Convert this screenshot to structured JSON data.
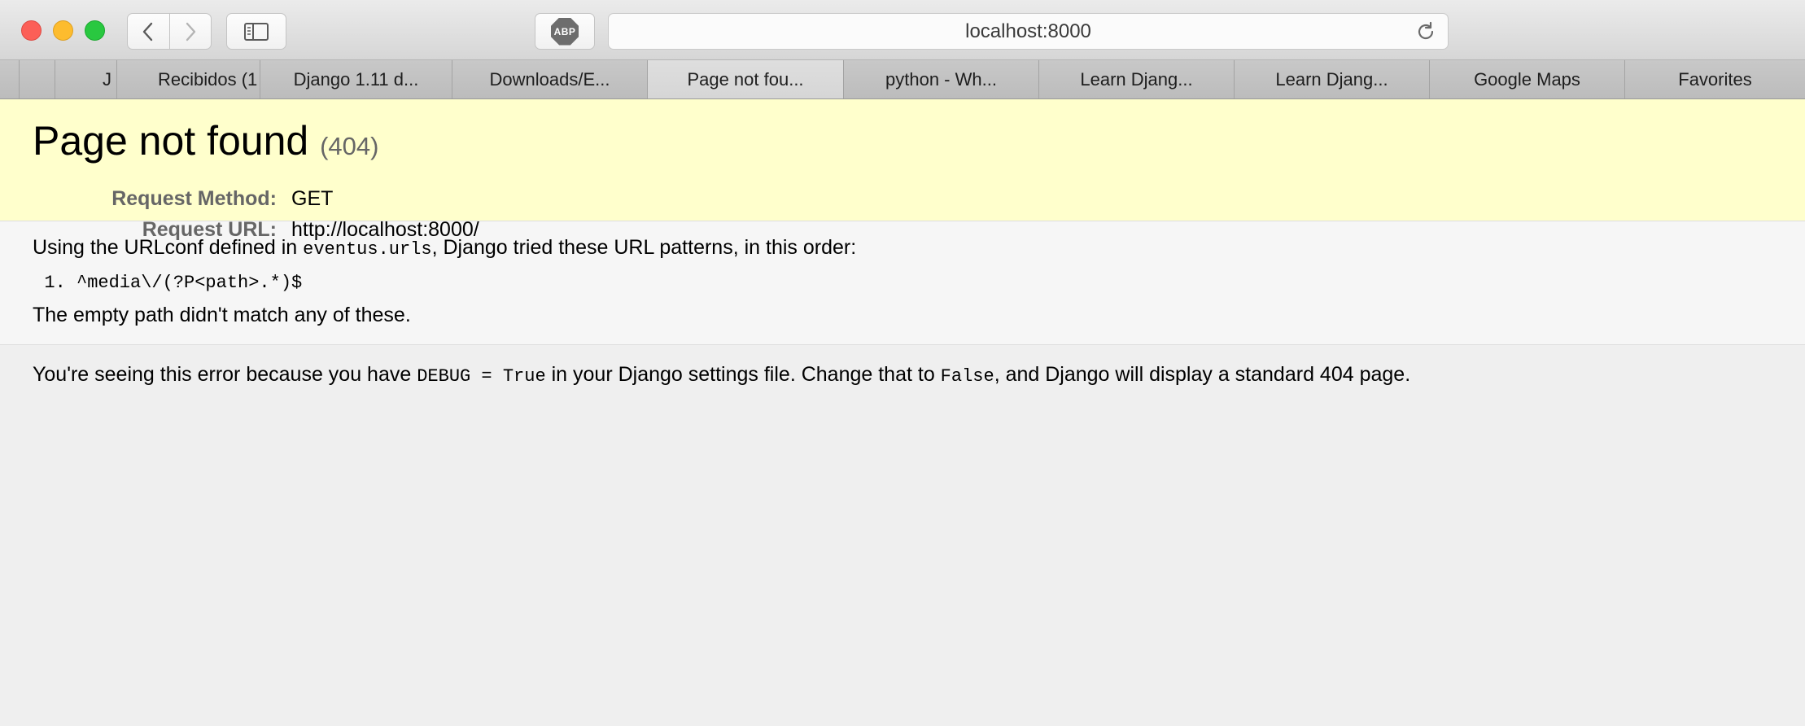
{
  "browser": {
    "address": "localhost:8000",
    "adblock_label": "ABP",
    "tabs": [
      {
        "label": ""
      },
      {
        "label": "J"
      },
      {
        "label": "Recibidos (1"
      },
      {
        "label": "Django 1.11 d..."
      },
      {
        "label": "Downloads/E..."
      },
      {
        "label": "Page not fou..."
      },
      {
        "label": "python - Wh..."
      },
      {
        "label": "Learn Djang..."
      },
      {
        "label": "Learn Djang..."
      },
      {
        "label": "Google Maps"
      },
      {
        "label": "Favorites"
      }
    ]
  },
  "page": {
    "title": "Page not found",
    "status_code": "(404)",
    "request_method_label": "Request Method:",
    "request_method": "GET",
    "request_url_label": "Request URL:",
    "request_url": "http://localhost:8000/",
    "urlconf_pre": "Using the URLconf defined in ",
    "urlconf_module": "eventus.urls",
    "urlconf_post": ", Django tried these URL patterns, in this order:",
    "patterns": [
      "^media\\/(?P<path>.*)$"
    ],
    "no_match": "The empty path didn't match any of these.",
    "debug_pre": "You're seeing this error because you have ",
    "debug_setting": "DEBUG = True",
    "debug_mid": " in your Django settings file. Change that to ",
    "debug_false": "False",
    "debug_post": ", and Django will display a standard 404 page."
  }
}
